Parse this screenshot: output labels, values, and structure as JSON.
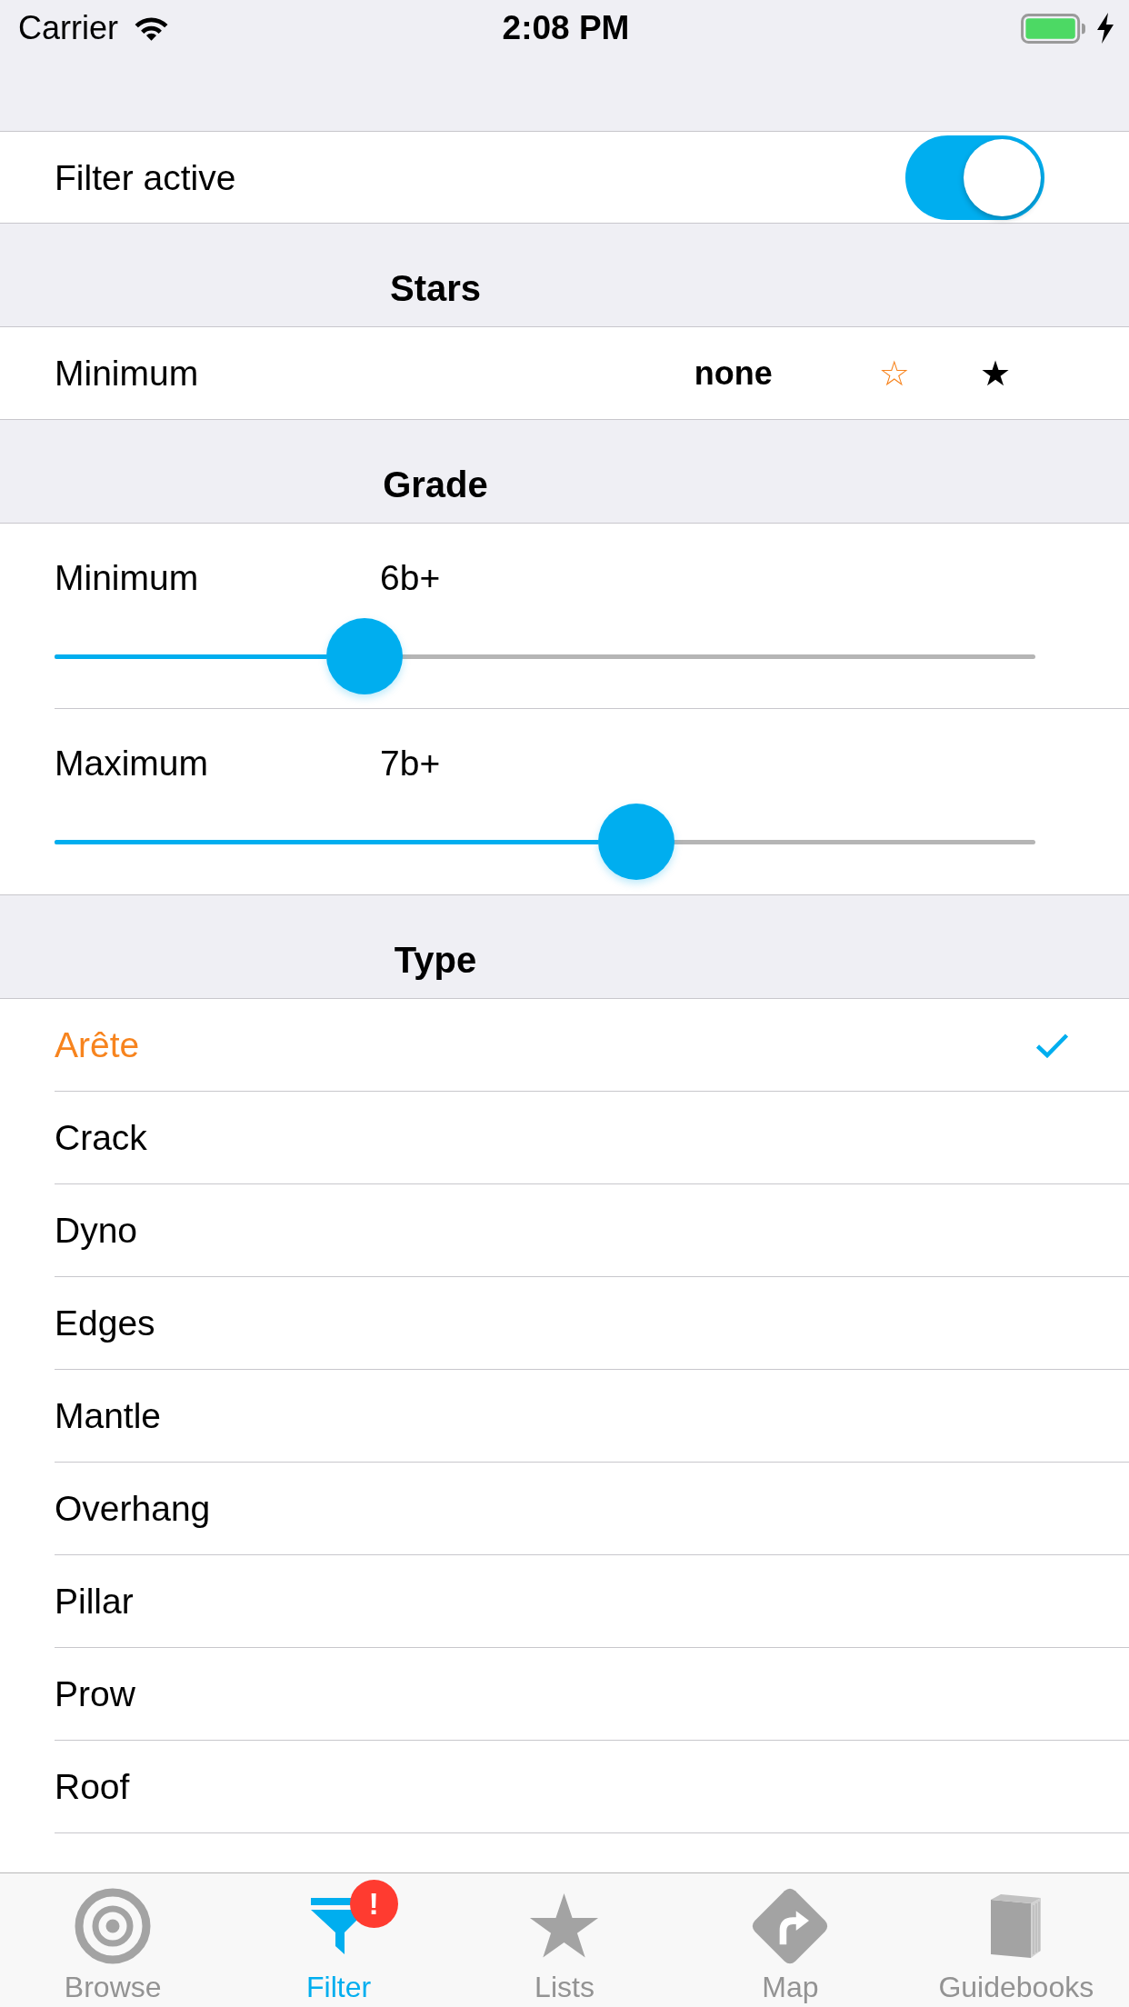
{
  "status_bar": {
    "carrier": "Carrier",
    "time": "2:08 PM"
  },
  "filter_toggle": {
    "label": "Filter active",
    "on": true
  },
  "stars_section": {
    "title": "Stars",
    "label": "Minimum",
    "options": [
      {
        "kind": "text",
        "label": "none",
        "selected": false
      },
      {
        "kind": "symbol",
        "label": "☆",
        "selected": true
      },
      {
        "kind": "symbol",
        "label": "★",
        "selected": false
      }
    ]
  },
  "grade_section": {
    "title": "Grade",
    "sliders": [
      {
        "label": "Minimum",
        "value": "6b+",
        "level": 0.316
      },
      {
        "label": "Maximum",
        "value": "7b+",
        "level": 0.593
      }
    ]
  },
  "type_section": {
    "title": "Type",
    "items": [
      {
        "label": "Arête",
        "selected": true
      },
      {
        "label": "Crack",
        "selected": false
      },
      {
        "label": "Dyno",
        "selected": false
      },
      {
        "label": "Edges",
        "selected": false
      },
      {
        "label": "Mantle",
        "selected": false
      },
      {
        "label": "Overhang",
        "selected": false
      },
      {
        "label": "Pillar",
        "selected": false
      },
      {
        "label": "Prow",
        "selected": false
      },
      {
        "label": "Roof",
        "selected": false
      }
    ]
  },
  "tab_bar": {
    "tabs": [
      {
        "label": "Browse",
        "selected": false
      },
      {
        "label": "Filter",
        "selected": true,
        "badge": "!"
      },
      {
        "label": "Lists",
        "selected": false
      },
      {
        "label": "Map",
        "selected": false
      },
      {
        "label": "Guidebooks",
        "selected": false
      }
    ]
  }
}
